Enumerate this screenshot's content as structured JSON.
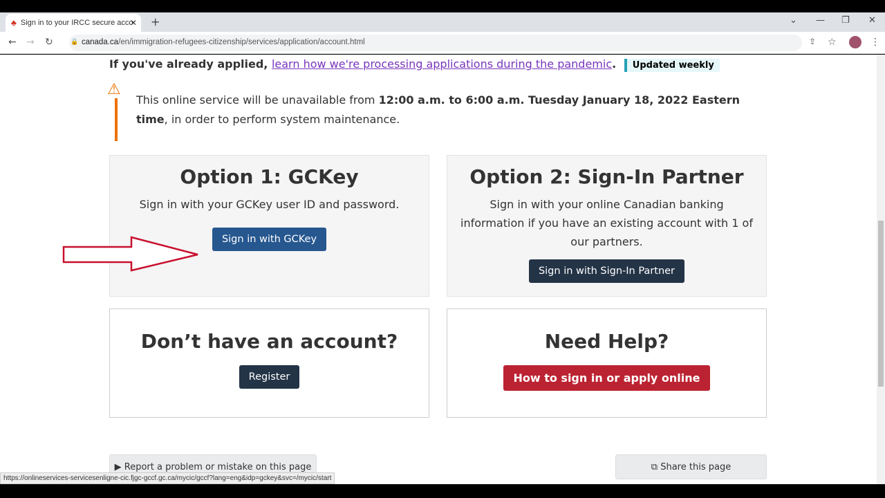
{
  "browser": {
    "tab_title": "Sign in to your IRCC secure acco",
    "url_host": "canada.ca",
    "url_path": "/en/immigration-refugees-citizenship/services/application/account.html",
    "status_url": "https://onlineservices-servicesenligne-cic.fjgc-gccf.gc.ca/mycic/gccf?lang=eng&idp=gckey&svc=/mycic/start"
  },
  "notice": {
    "prefix": "If you've already applied,",
    "link": "learn how we're processing applications during the pandemic",
    "badge": "Updated weekly"
  },
  "warning": {
    "t1": "This online service will be unavailable from ",
    "bold": "12:00 a.m. to 6:00 a.m. Tuesday January 18, 2022 Eastern time",
    "t2": ", in order to perform system maintenance."
  },
  "option1": {
    "title": "Option 1: GCKey",
    "desc": "Sign in with your GCKey user ID and password.",
    "button": "Sign in with GCKey"
  },
  "option2": {
    "title": "Option 2: Sign-In Partner",
    "desc": "Sign in with your online Canadian banking information if you have an existing account with 1 of our partners.",
    "button": "Sign in with Sign-In Partner"
  },
  "register": {
    "title": "Don’t have an account?",
    "button": "Register"
  },
  "help": {
    "title": "Need Help?",
    "button": "How to sign in or apply online"
  },
  "footer": {
    "report": "Report a problem or mistake on this page",
    "share": "Share this page"
  },
  "colors": {
    "gckey_btn": "#26578f",
    "dark_btn": "#243447",
    "red_btn": "#bc2332",
    "warning": "#ee7100"
  }
}
